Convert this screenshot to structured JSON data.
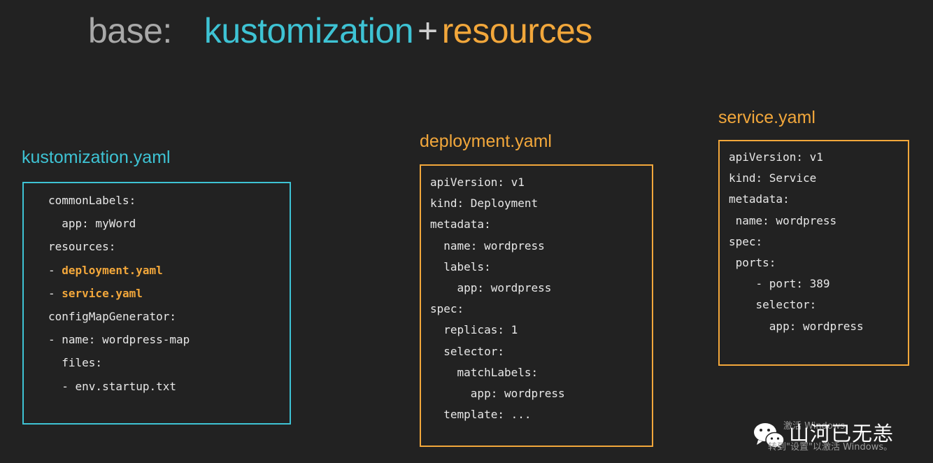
{
  "title": {
    "base": "base:",
    "kustomization": "kustomization",
    "plus": "+",
    "resources": "resources"
  },
  "files": {
    "kustomization": {
      "name": "kustomization.yaml",
      "lines": [
        "commonLabels:",
        "  app: myWord",
        "resources:",
        "- deployment.yaml",
        "- service.yaml",
        "configMapGenerator:",
        "- name: wordpress-map",
        "  files:",
        "  - env.startup.txt"
      ],
      "highlight_prefix": "- ",
      "highlight_items": [
        "deployment.yaml",
        "service.yaml"
      ]
    },
    "deployment": {
      "name": "deployment.yaml",
      "lines": [
        "apiVersion: v1",
        "kind: Deployment",
        "metadata:",
        "  name: wordpress",
        "  labels:",
        "    app: wordpress",
        "spec:",
        "  replicas: 1",
        "  selector:",
        "    matchLabels:",
        "      app: wordpress",
        "  template: ..."
      ]
    },
    "service": {
      "name": "service.yaml",
      "lines": [
        "apiVersion: v1",
        "kind: Service",
        "metadata:",
        " name: wordpress",
        "spec:",
        " ports:",
        "    - port: 389",
        "    selector:",
        "      app: wordpress"
      ]
    }
  },
  "watermark": {
    "account": "山河已无恙",
    "activate_line1": "激活 Windows",
    "activate_line2": "转到\"设置\"以激活 Windows。"
  },
  "colors": {
    "background": "#222222",
    "cyan": "#3ec3d4",
    "orange": "#f2a73b",
    "grey_title": "#a9a9a9",
    "code_text": "#e8e8e8"
  }
}
